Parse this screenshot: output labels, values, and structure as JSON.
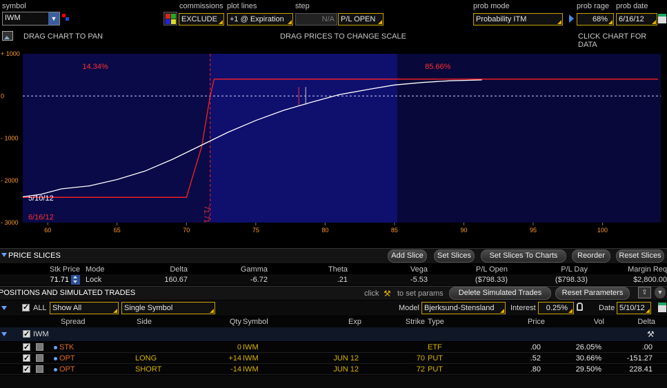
{
  "header": {
    "symbol_label": "symbol",
    "symbol_value": "IWM",
    "commissions_label": "commissions",
    "commissions_value": "EXCLUDE",
    "plot_lines_label": "plot lines",
    "plot_lines_value": "+1 @ Expiration",
    "step_label": "step",
    "step_value": "N/A",
    "pl_mode_value": "P/L OPEN",
    "prob_mode_label": "prob mode",
    "prob_mode_value": "Probability ITM",
    "prob_range_label": "prob rage",
    "prob_range_value": "68%",
    "prob_date_label": "prob date",
    "prob_date_value": "6/16/12"
  },
  "chart_toolbar": {
    "pan_hint": "DRAG CHART TO PAN",
    "scale_hint": "DRAG PRICES TO CHANGE SCALE",
    "click_hint": "CLICK CHART FOR DATA"
  },
  "chart_data": {
    "type": "line",
    "x_ticks": [
      "60",
      "65",
      "70",
      "75",
      "80",
      "85",
      "90",
      "95",
      "100"
    ],
    "y_ticks": [
      "+ 1000",
      "0",
      "- 1000",
      "- 2000",
      "- 3000"
    ],
    "xlim": [
      58.2,
      104.2
    ],
    "ylim": [
      -3000,
      1000
    ],
    "left_prob": "14.34%",
    "right_prob": "85.66%",
    "strike_label": "71.71",
    "strike_x": 71.71,
    "date_white": "5/10/12",
    "date_red": "6/16/12",
    "series": [
      {
        "color": "#ff2020",
        "x": [
          58.2,
          70,
          71.1,
          71.71,
          72,
          104
        ],
        "y": [
          -2400,
          -2400,
          -1200,
          0,
          400,
          400
        ]
      },
      {
        "color": "#ffffff",
        "x": [
          58.2,
          59.5,
          61,
          63,
          65,
          67,
          69,
          71,
          73,
          75,
          77,
          79,
          81,
          83,
          85,
          87,
          89,
          91.3
        ],
        "y": [
          -2390,
          -2330,
          -2200,
          -2130,
          -1980,
          -1780,
          -1500,
          -1180,
          -860,
          -580,
          -340,
          -150,
          30,
          150,
          260,
          320,
          360,
          380
        ]
      }
    ],
    "markers_x": [
      78.1,
      78.6
    ]
  },
  "price_slices": {
    "title": "PRICE SLICES",
    "buttons": [
      "Add Slice",
      "Set Slices",
      "Set Slices To Charts",
      "Reorder",
      "Reset Slices"
    ],
    "headers": [
      "Stk Price",
      "Mode",
      "Delta",
      "Gamma",
      "Theta",
      "Vega",
      "P/L Open",
      "P/L Day",
      "Margin Req"
    ],
    "row": {
      "stk_price": "71.71",
      "mode": "Lock",
      "delta": "160.67",
      "gamma": "-6.72",
      "theta": ".21",
      "vega": "-5.53",
      "pl_open": "($798.33)",
      "pl_day": "($798.33)",
      "margin": "$2,800.00"
    }
  },
  "positions": {
    "title": "POSITIONS AND SIMULATED TRADES",
    "click_text": "click",
    "params_text": "to set params",
    "delete_button": "Delete Simulated Trades",
    "reset_button": "Reset Parameters",
    "all_label": "ALL",
    "show_value": "Show All",
    "symbol_filter": "Single Symbol",
    "model_label": "Model",
    "model_value": "Bjerksund-Stensland",
    "interest_label": "Interest",
    "interest_value": "0.25%",
    "date_label": "Date",
    "date_value": "5/10/12",
    "headers": [
      "Spread",
      "Side",
      "Qty",
      "Symbol",
      "Exp",
      "Strike",
      "Type",
      "Price",
      "Vol",
      "Delta"
    ],
    "group_symbol": "IWM",
    "rows": [
      {
        "spread": "STK",
        "side": "",
        "qty": "0",
        "symbol": "IWM",
        "exp": "",
        "strike": "",
        "type": "ETF",
        "price": ".00",
        "vol": "26.05%",
        "delta": ".00"
      },
      {
        "spread": "OPT",
        "side": "LONG",
        "qty": "+14",
        "symbol": "IWM",
        "exp": "JUN 12",
        "strike": "70",
        "type": "PUT",
        "price": ".52",
        "vol": "30.66%",
        "delta": "-151.27"
      },
      {
        "spread": "OPT",
        "side": "SHORT",
        "qty": "-14",
        "symbol": "IWM",
        "exp": "JUN 12",
        "strike": "72",
        "type": "PUT",
        "price": ".80",
        "vol": "29.50%",
        "delta": "228.41"
      }
    ]
  },
  "colors": {
    "chart_bg": "#0f0f6e",
    "chart_bg_dark": "#0a0a4e",
    "accent_yellow": "#c8a200",
    "loss_red": "#ff2020"
  }
}
